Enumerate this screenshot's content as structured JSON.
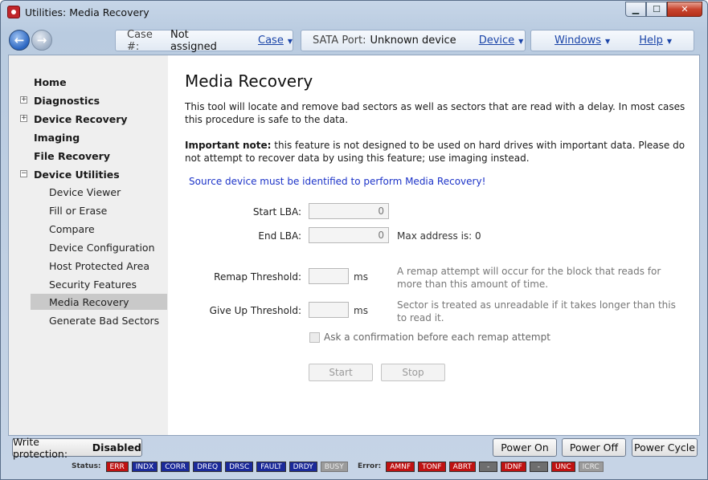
{
  "window": {
    "title": "Utilities: Media Recovery"
  },
  "toolbar": {
    "case_label": "Case #:",
    "case_value": "Not assigned",
    "case_menu": "Case",
    "sata_label": "SATA Port:",
    "sata_value": "Unknown device",
    "device_menu": "Device",
    "windows_menu": "Windows",
    "help_menu": "Help"
  },
  "sidebar": {
    "items": [
      {
        "label": "Home"
      },
      {
        "label": "Diagnostics"
      },
      {
        "label": "Device Recovery"
      },
      {
        "label": "Imaging"
      },
      {
        "label": "File Recovery"
      },
      {
        "label": "Device Utilities"
      }
    ],
    "sub_items": [
      {
        "label": "Device Viewer"
      },
      {
        "label": "Fill or Erase"
      },
      {
        "label": "Compare"
      },
      {
        "label": "Device Configuration"
      },
      {
        "label": "Host Protected Area"
      },
      {
        "label": "Security Features"
      },
      {
        "label": "Media Recovery"
      },
      {
        "label": "Generate Bad Sectors"
      }
    ],
    "expanders": {
      "collapsed": "+",
      "expanded": "−"
    }
  },
  "main": {
    "title": "Media Recovery",
    "intro": "This tool will locate and remove bad sectors as well as sectors that are read with a delay. In most cases this procedure is safe to the data.",
    "note_bold": "Important note:",
    "note_text": " this feature is not designed to be used on hard drives with important data. Please do not attempt to recover data by using this feature; use imaging instead.",
    "warning": "Source device must be identified to perform Media Recovery!",
    "start_lba_label": "Start LBA:",
    "start_lba_value": "0",
    "end_lba_label": "End LBA:",
    "end_lba_value": "0",
    "max_address": "Max address is: 0",
    "remap_label": "Remap Threshold:",
    "remap_value": "",
    "remap_unit": "ms",
    "remap_hint": "A remap attempt will occur for the block that reads for more than this amount of time.",
    "giveup_label": "Give Up Threshold:",
    "giveup_value": "",
    "giveup_unit": "ms",
    "giveup_hint": "Sector is treated as unreadable if it takes longer than this to read it.",
    "confirm_label": "Ask a confirmation before each remap attempt",
    "start_button": "Start",
    "stop_button": "Stop"
  },
  "bottom": {
    "write_protect_label": "Write protection:",
    "write_protect_value": "Disabled",
    "power_on": "Power On",
    "power_off": "Power Off",
    "power_cycle": "Power Cycle",
    "status_label": "Status:",
    "status_flags": [
      "ERR",
      "INDX",
      "CORR",
      "DREQ",
      "DRSC",
      "FAULT",
      "DRDY",
      "BUSY"
    ],
    "error_label": "Error:",
    "error_flags": [
      "AMNF",
      "TONF",
      "ABRT",
      "-",
      "IDNF",
      "-",
      "UNC",
      "ICRC"
    ]
  },
  "colors": {
    "flag_blue": "#1b2a9a",
    "flag_red": "#c01212",
    "warning_text": "#1c33c8",
    "selected_nav": "#c9c9c9"
  }
}
